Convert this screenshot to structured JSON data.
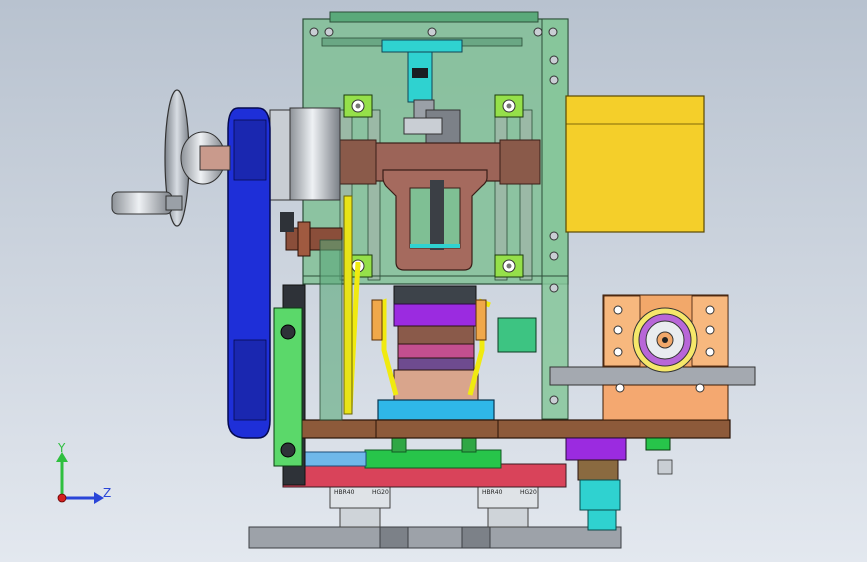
{
  "colors": {
    "background_top": "#b8c2cf",
    "background_bottom": "#e3e8ef",
    "frame_green": "#7fbf94",
    "frame_green_dark": "#4f8f68",
    "belt_blue": "#1e2fd8",
    "motor_yellow": "#f4cf2a",
    "plate_brown": "#8a5a4a",
    "base_red": "#d9435a",
    "base_green": "#27c44a",
    "block_cyan": "#2fb7e8",
    "flange_orange": "#f2a86a",
    "steel_gray": "#9a9fa6",
    "purple": "#9b2be0",
    "axis_y": "#2fbf3f",
    "axis_z": "#2a45d8",
    "axis_origin": "#d42020"
  },
  "rails": {
    "left_label_a": "HBR40",
    "left_label_b": "HG20",
    "right_label_a": "HBR40",
    "right_label_b": "HG20"
  },
  "axis": {
    "y_label": "Y",
    "z_label": "Z"
  }
}
